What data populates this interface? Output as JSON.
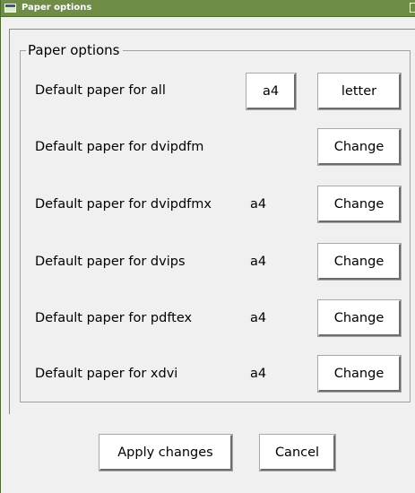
{
  "window": {
    "title": "Paper options"
  },
  "group": {
    "legend": "Paper options"
  },
  "rows": [
    {
      "label": "Default paper for all",
      "value": "a4",
      "button": "letter"
    },
    {
      "label": "Default paper for dvipdfm",
      "value": "",
      "button": "Change"
    },
    {
      "label": "Default paper for dvipdfmx",
      "value": "a4",
      "button": "Change"
    },
    {
      "label": "Default paper for dvips",
      "value": "a4",
      "button": "Change"
    },
    {
      "label": "Default paper for pdftex",
      "value": "a4",
      "button": "Change"
    },
    {
      "label": "Default paper for xdvi",
      "value": "a4",
      "button": "Change"
    }
  ],
  "footer": {
    "apply_label": "Apply changes",
    "cancel_label": "Cancel"
  },
  "colors": {
    "titlebar": "#6f8d47",
    "window_bg": "#f0f0f0",
    "button_bg": "#ffffff"
  }
}
